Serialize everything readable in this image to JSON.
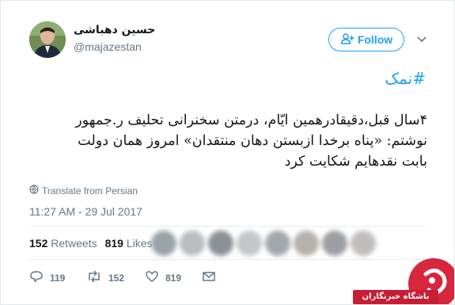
{
  "author": {
    "display_name": "حسین دهباشی",
    "handle": "@majazestan"
  },
  "follow_button": {
    "label": "Follow"
  },
  "tweet": {
    "hashtag": "#نمک",
    "lines": [
      "۴سال قبل،دقیقادرهمین ایّام، درمتن سخنرانی تحلیف ر.جمهور",
      "نوشتم: «پناه برخدا ازبستن دهان منتقدان» امروز همان دولت",
      "بابت نقدهایم شکایت کرد"
    ],
    "translate_label": "Translate from Persian",
    "timestamp": "11:27 AM - 29 Jul 2017"
  },
  "stats": {
    "retweets_count": "152",
    "retweets_label": "Retweets",
    "likes_count": "819",
    "likes_label": "Likes"
  },
  "actions": {
    "reply_count": "119",
    "retweet_count": "152",
    "like_count": "819"
  },
  "watermark": {
    "label": "باشگاه خبرنگاران"
  },
  "colors": {
    "accent": "#1da1f2",
    "text_primary": "#14171a",
    "text_secondary": "#657786",
    "watermark_red": "#d7263d"
  },
  "icons": {
    "follow": "add-person-icon",
    "caret": "chevron-down-icon",
    "translate": "globe-icon",
    "reply": "reply-icon",
    "retweet": "retweet-icon",
    "like": "heart-icon",
    "message": "envelope-icon"
  }
}
